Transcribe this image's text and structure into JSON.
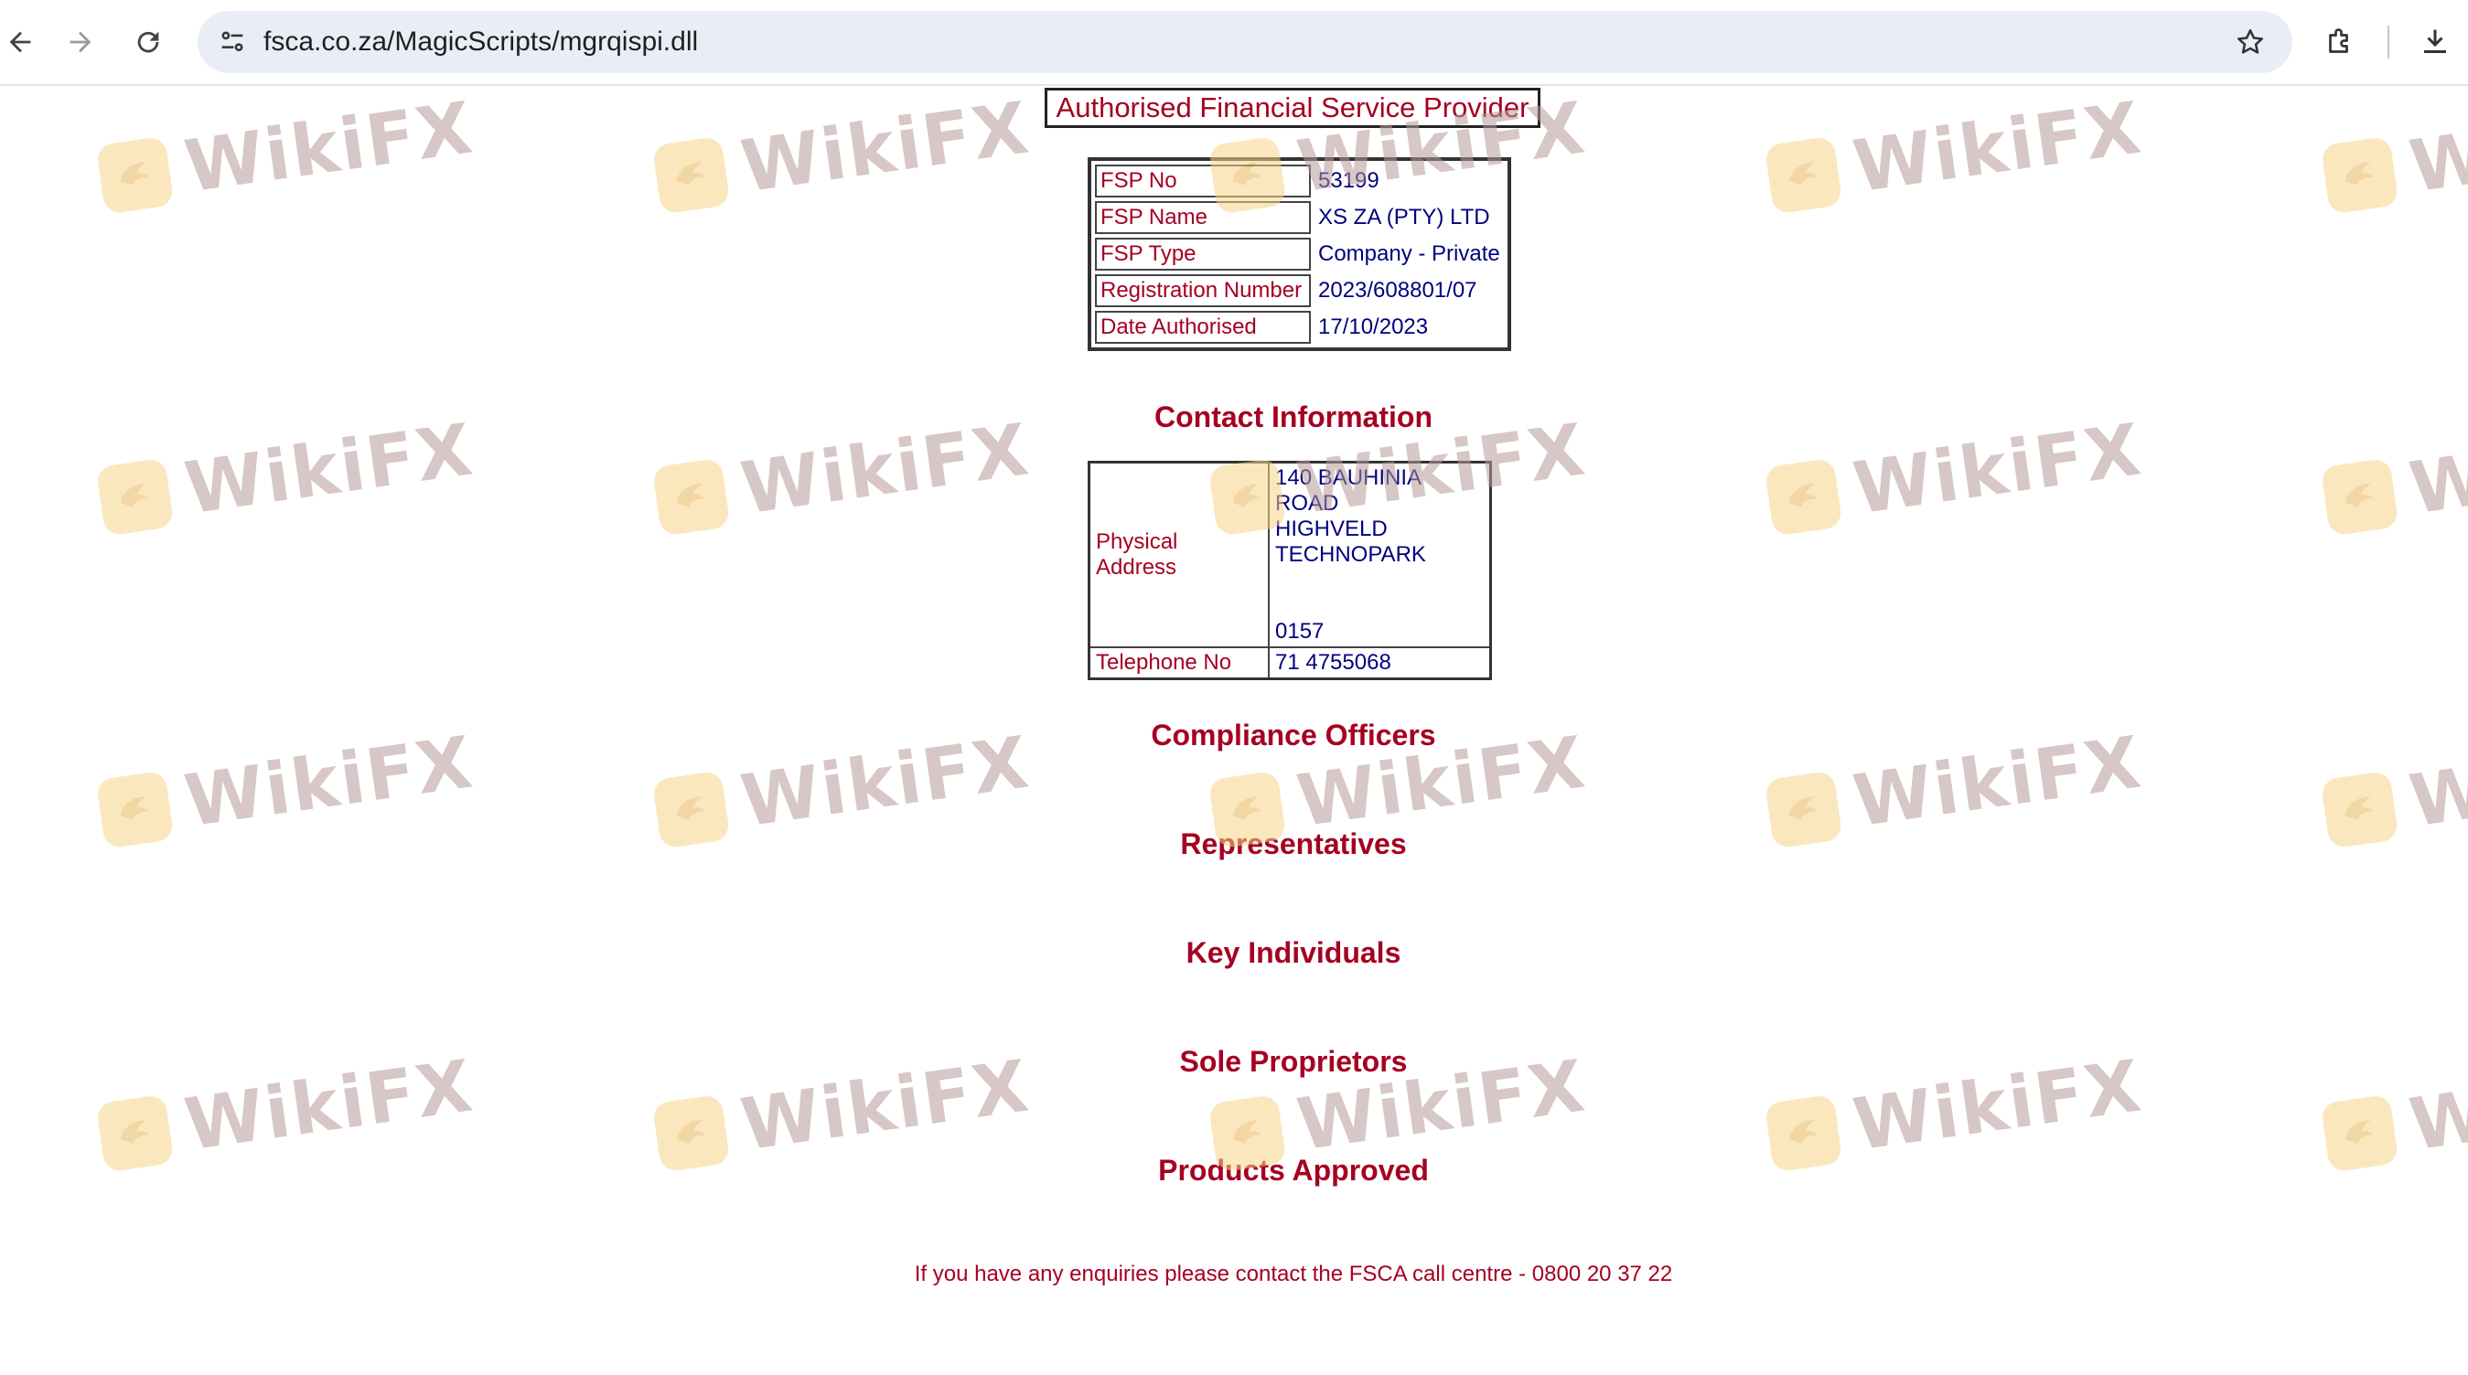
{
  "browser": {
    "url": "fsca.co.za/MagicScripts/mgrqispi.dll",
    "icons": [
      "back-arrow-icon",
      "forward-arrow-icon",
      "reload-icon",
      "site-info-icon",
      "star-icon",
      "extensions-icon",
      "download-icon"
    ]
  },
  "page": {
    "main_title": "Authorised Financial Service Provider",
    "fsp_details": [
      {
        "label": "FSP No",
        "value": "53199"
      },
      {
        "label": "FSP Name",
        "value": "XS ZA (PTY) LTD"
      },
      {
        "label": "FSP Type",
        "value": "Company - Private"
      },
      {
        "label": "Registration Number",
        "value": "2023/608801/07"
      },
      {
        "label": "Date Authorised",
        "value": "17/10/2023"
      }
    ],
    "contact_heading": "Contact Information",
    "contact": {
      "address_label": "Physical Address",
      "address_lines": [
        "140 BAUHINIA ROAD",
        "HIGHVELD",
        "TECHNOPARK",
        "",
        "",
        "0157"
      ],
      "phone_label": "Telephone No",
      "phone_value": "71 4755068"
    },
    "sections": {
      "compliance": "Compliance Officers",
      "representatives": "Representatives",
      "key_individuals": "Key Individuals",
      "sole_proprietors": "Sole Proprietors",
      "products": "Products Approved"
    },
    "footer": "If you have any enquiries please contact the FSCA call centre - 0800 20 37 22"
  },
  "watermark": {
    "text": "WikiFX"
  },
  "colors": {
    "label": "#a50021",
    "value": "#000080",
    "omnibox": "#e9eef6"
  }
}
